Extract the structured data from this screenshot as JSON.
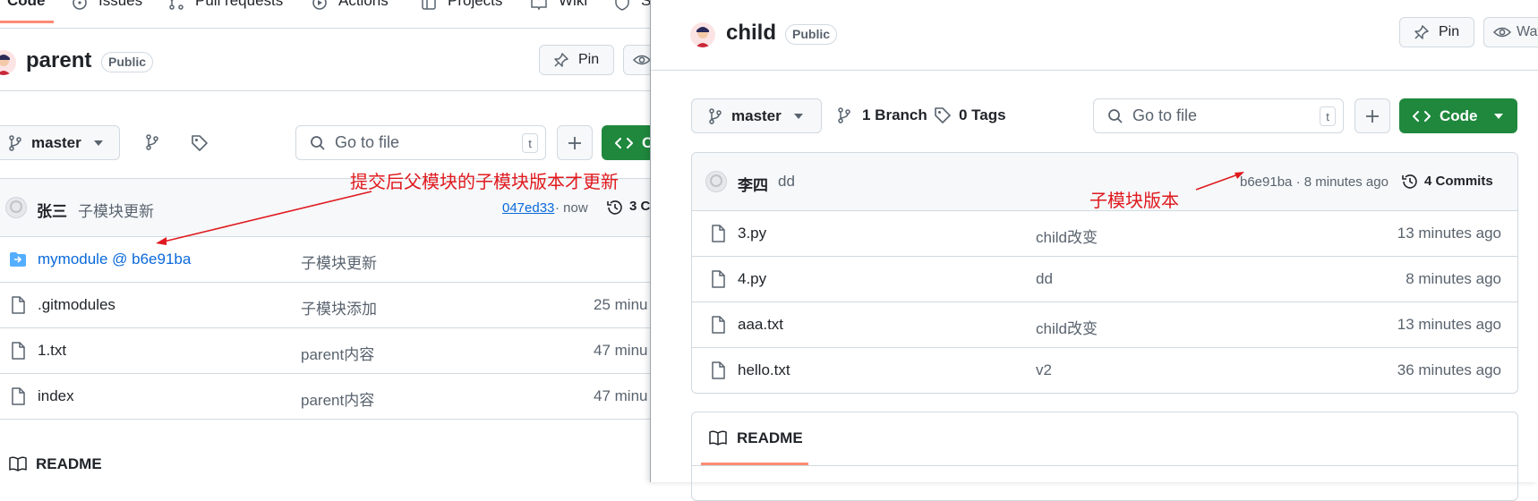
{
  "left": {
    "tabs": [
      "Code",
      "Issues",
      "Pull requests",
      "Actions",
      "Projects",
      "Wiki",
      "S"
    ],
    "repo_name": "parent",
    "visibility": "Public",
    "pin_label": "Pin",
    "branch": "master",
    "search_placeholder": "Go to file",
    "shortcut_key": "t",
    "code_label": "C",
    "commit": {
      "author": "张三",
      "message": "子模块更新",
      "hash": "047ed33",
      "time": "· now",
      "count": "3 C"
    },
    "annotation": "提交后父模块的子模块版本才更新",
    "files": [
      {
        "name": "mymodule @ b6e91ba",
        "message": "子模块更新",
        "time": "",
        "type": "submodule"
      },
      {
        "name": ".gitmodules",
        "message": "子模块添加",
        "time": "25 minu",
        "type": "file"
      },
      {
        "name": "1.txt",
        "message": "parent内容",
        "time": "47 minu",
        "type": "file"
      },
      {
        "name": "index",
        "message": "parent内容",
        "time": "47 minu",
        "type": "file"
      }
    ],
    "readme_label": "README"
  },
  "right": {
    "repo_name": "child",
    "visibility": "Public",
    "pin_label": "Pin",
    "watch_label": "Wat",
    "branch": "master",
    "branches": "1 Branch",
    "tags": "0 Tags",
    "search_placeholder": "Go to file",
    "shortcut_key": "t",
    "code_label": "Code",
    "commit": {
      "author": "李四",
      "message": "dd",
      "hash_time": "b6e91ba · 8 minutes ago",
      "commits": "4 Commits"
    },
    "annotation": "子模块版本",
    "files": [
      {
        "name": "3.py",
        "message": "child改变",
        "time": "13 minutes ago"
      },
      {
        "name": "4.py",
        "message": "dd",
        "time": "8 minutes ago"
      },
      {
        "name": "aaa.txt",
        "message": "child改变",
        "time": "13 minutes ago"
      },
      {
        "name": "hello.txt",
        "message": "v2",
        "time": "36 minutes ago"
      }
    ],
    "readme_label": "README"
  },
  "colors": {
    "accent_green": "#1f883d",
    "annotation_red": "#e0191e",
    "link_blue": "#0969da",
    "readme_underline": "#fd8c73"
  }
}
